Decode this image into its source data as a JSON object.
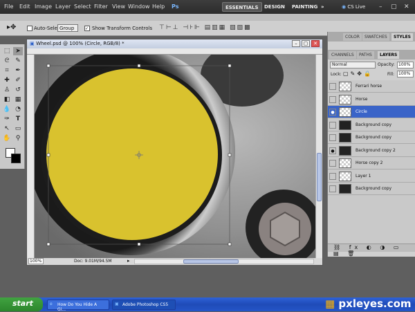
{
  "menubar": {
    "items": [
      "File",
      "Edit",
      "Image",
      "Layer",
      "Select",
      "Filter",
      "View",
      "Window",
      "Help"
    ],
    "ps_logo": "Ps",
    "workspaces": [
      "ESSENTIALS",
      "DESIGN",
      "PAINTING"
    ],
    "more": "»",
    "cslive": "CS Live"
  },
  "options": {
    "auto_select_label": "Auto-Select:",
    "auto_select_value": "Group",
    "transform_label": "Show Transform Controls"
  },
  "document": {
    "title": "Wheel.psd @ 100% (Circle, RGB/8) *",
    "zoom": "100%",
    "doc_info": "Doc: 9.01M/94.5M"
  },
  "panels": {
    "top_tabs": [
      "COLOR",
      "SWATCHES",
      "STYLES"
    ],
    "layer_tabs": [
      "CHANNELS",
      "PATHS",
      "LAYERS"
    ],
    "blend_mode": "Normal",
    "opacity_label": "Opacity:",
    "opacity_value": "100%",
    "lock_label": "Lock:",
    "fill_label": "Fill:",
    "fill_value": "100%",
    "layers": [
      {
        "name": "Ferrari horse",
        "visible": false,
        "selected": false,
        "dark": false
      },
      {
        "name": "Horse",
        "visible": false,
        "selected": false,
        "dark": false
      },
      {
        "name": "Circle",
        "visible": true,
        "selected": true,
        "dark": false
      },
      {
        "name": "Background copy",
        "visible": false,
        "selected": false,
        "dark": true
      },
      {
        "name": "Background copy",
        "visible": false,
        "selected": false,
        "dark": true
      },
      {
        "name": "Background copy 2",
        "visible": true,
        "selected": false,
        "dark": true
      },
      {
        "name": "Horse copy 2",
        "visible": false,
        "selected": false,
        "dark": false
      },
      {
        "name": "Layer 1",
        "visible": false,
        "selected": false,
        "dark": false
      },
      {
        "name": "Background copy",
        "visible": false,
        "selected": false,
        "dark": true
      }
    ]
  },
  "taskbar": {
    "start": "start",
    "tasks": [
      "How Do You Hide A Gi...",
      "Adobe Photoshop CS5"
    ]
  },
  "watermark": "pxleyes.com",
  "colors": {
    "circle_fill": "#d9c22e",
    "selection_blue": "#3a64c8"
  }
}
